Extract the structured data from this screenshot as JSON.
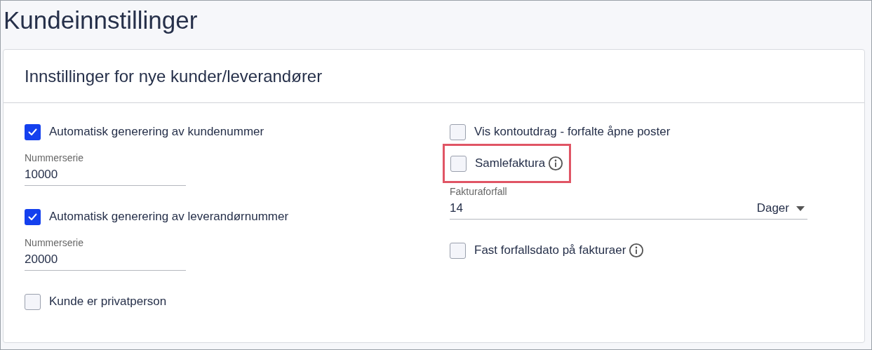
{
  "page_title": "Kundeinnstillinger",
  "card": {
    "title": "Innstillinger for nye kunder/leverandører",
    "columns": [
      {
        "items": [
          {
            "kind": "checkbox",
            "label": "Automatisk generering av kundenummer",
            "checked": true,
            "info": false,
            "highlighted": false
          },
          {
            "kind": "field",
            "label": "Nummerserie",
            "value": "10000"
          },
          {
            "kind": "checkbox",
            "label": "Automatisk generering av leverandørnummer",
            "checked": true,
            "info": false,
            "highlighted": false
          },
          {
            "kind": "field",
            "label": "Nummerserie",
            "value": "20000"
          },
          {
            "kind": "checkbox",
            "label": "Kunde er privatperson",
            "checked": false,
            "info": false,
            "highlighted": false
          }
        ]
      },
      {
        "items": [
          {
            "kind": "checkbox",
            "label": "Vis kontoutdrag - forfalte åpne poster",
            "checked": false,
            "info": false,
            "highlighted": false
          },
          {
            "kind": "checkbox",
            "label": "Samlefaktura",
            "checked": false,
            "info": true,
            "highlighted": true
          },
          {
            "kind": "unit_field",
            "label": "Fakturaforfall",
            "value": "14",
            "unit": "Dager"
          },
          {
            "kind": "checkbox",
            "label": "Fast forfallsdato på fakturaer",
            "checked": false,
            "info": true,
            "highlighted": false
          }
        ]
      }
    ]
  }
}
